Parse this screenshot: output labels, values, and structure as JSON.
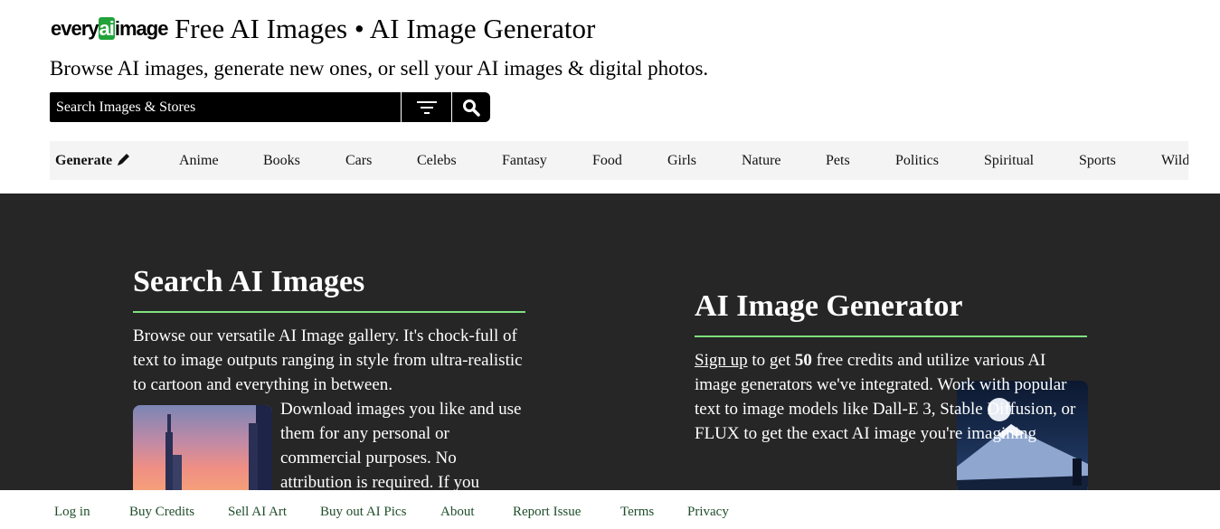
{
  "header": {
    "logo_prefix": "every",
    "logo_ai": "ai",
    "logo_suffix": "image",
    "title": "Free AI Images • AI Image Generator",
    "tagline": "Browse AI images, generate new ones, or sell your AI images & digital photos."
  },
  "search": {
    "placeholder": "Search Images & Stores",
    "filter_icon": "filter-icon",
    "search_icon": "search-icon"
  },
  "categories": {
    "generate_label": "Generate",
    "generate_icon": "pencil-icon",
    "items": [
      "Anime",
      "Books",
      "Cars",
      "Celebs",
      "Fantasy",
      "Food",
      "Girls",
      "Nature",
      "Pets",
      "Politics",
      "Spiritual",
      "Sports",
      "Wild"
    ]
  },
  "search_section": {
    "title": "Search AI Images",
    "paragraph_top": "Browse our versatile AI Image gallery. It's chock-full of text to image outputs ranging in style from ultra-realistic to cartoon and everything in between.",
    "paragraph_side": "Download images you like and use them for any personal or commercial purposes. No attribution is required. If you"
  },
  "generator_section": {
    "title": "AI Image Generator",
    "signup_link": "Sign up",
    "text_1": " to get ",
    "credits": "50",
    "text_2": " free credits and utilize various AI image generators we've integrated. Work with popular text to image models like Dall-E 3, Stable Diffusion, or FLUX to get the exact AI image you're imagining"
  },
  "footer": {
    "links": [
      "Log in",
      "Buy Credits",
      "Sell AI Art",
      "Buy out AI Pics",
      "About",
      "Report Issue",
      "Terms",
      "Privacy"
    ]
  },
  "colors": {
    "accent_green": "#7ee07e",
    "dark_bg": "#262626",
    "footer_link": "#1f4d2a",
    "logo_ai_bg": "#21a33a"
  }
}
